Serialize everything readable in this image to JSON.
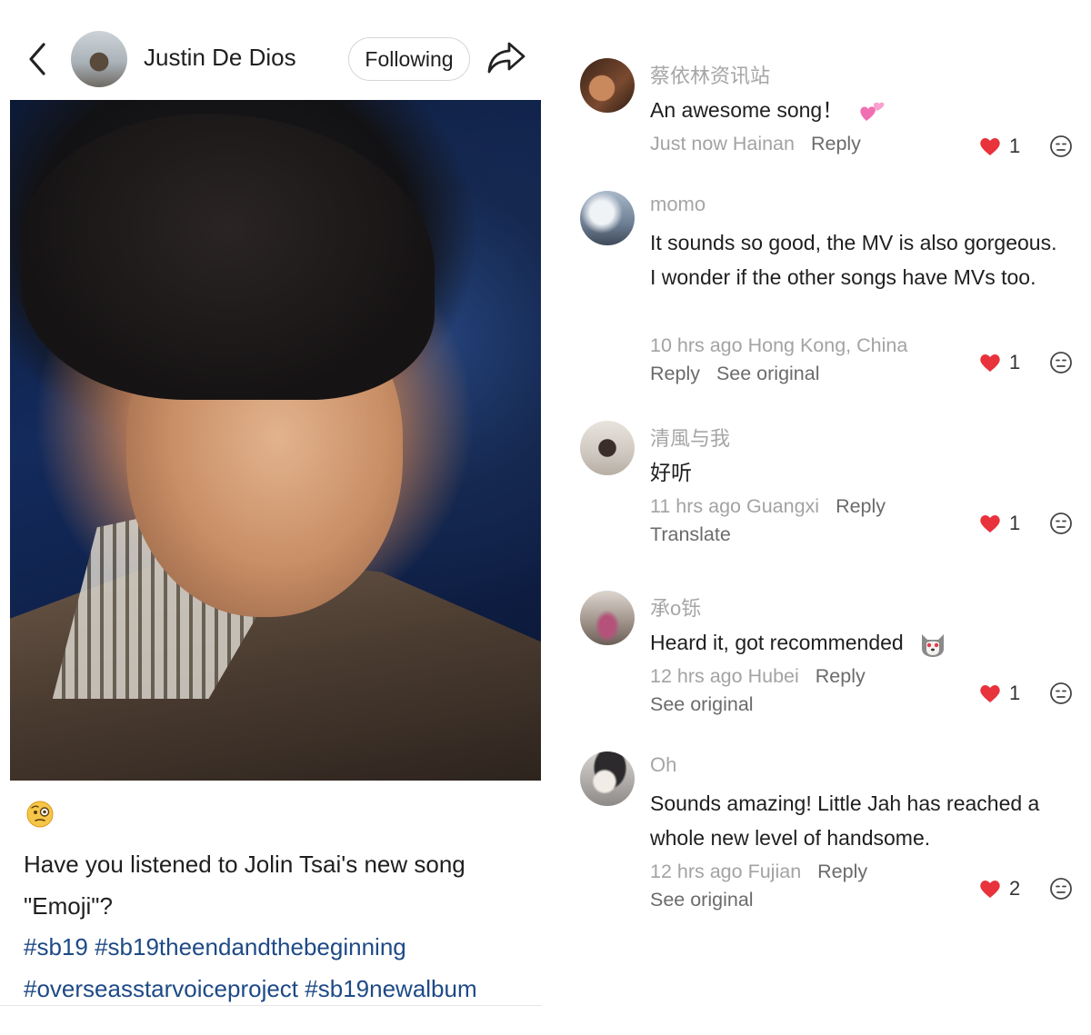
{
  "post": {
    "author_name": "Justin De Dios",
    "follow_label": "Following",
    "caption": "Have you listened to Jolin Tsai's new song \"Emoji\"?",
    "hashtags": [
      "#sb19",
      "#sb19theendandthebeginning",
      "#overseasstarvoiceproject",
      "#sb19newalbum"
    ],
    "leading_emoji": "monocle-face-emoji"
  },
  "comments": [
    {
      "user": "蔡依林资讯站",
      "text": "An awesome song！",
      "trailing_emoji": "two-hearts-emoji",
      "time": "Just now",
      "location": "Hainan",
      "reply_label": "Reply",
      "extra_action": "",
      "likes": "1"
    },
    {
      "user": "momo",
      "text": "It sounds so good, the MV is also gorgeous. I wonder if the other songs have MVs too.",
      "trailing_emoji": "",
      "time": "10 hrs ago",
      "location": "Hong Kong, China",
      "reply_label": "Reply",
      "extra_action": "See original",
      "likes": "1"
    },
    {
      "user": "清風与我",
      "text": "好听",
      "trailing_emoji": "",
      "time": "11 hrs ago",
      "location": "Guangxi",
      "reply_label": "Reply",
      "extra_action": "Translate",
      "likes": "1"
    },
    {
      "user": "承o铄",
      "text": "Heard it, got recommended",
      "trailing_emoji": "husky-dog-emoji",
      "time": "12 hrs ago",
      "location": "Hubei",
      "reply_label": "Reply",
      "extra_action": "See original",
      "likes": "1"
    },
    {
      "user": "Oh",
      "text": "Sounds amazing! Little Jah has reached a whole new level of handsome.",
      "trailing_emoji": "",
      "time": "12 hrs ago",
      "location": "Fujian",
      "reply_label": "Reply",
      "extra_action": "See original",
      "likes": "2"
    }
  ],
  "colors": {
    "hashtag": "#1e4a86",
    "heart": "#e8323c",
    "meta_gray": "#a3a3a3",
    "action_gray": "#6b6b6b"
  },
  "icons": [
    "back-chevron-icon",
    "share-arrow-icon",
    "heart-icon",
    "dislike-face-icon"
  ]
}
